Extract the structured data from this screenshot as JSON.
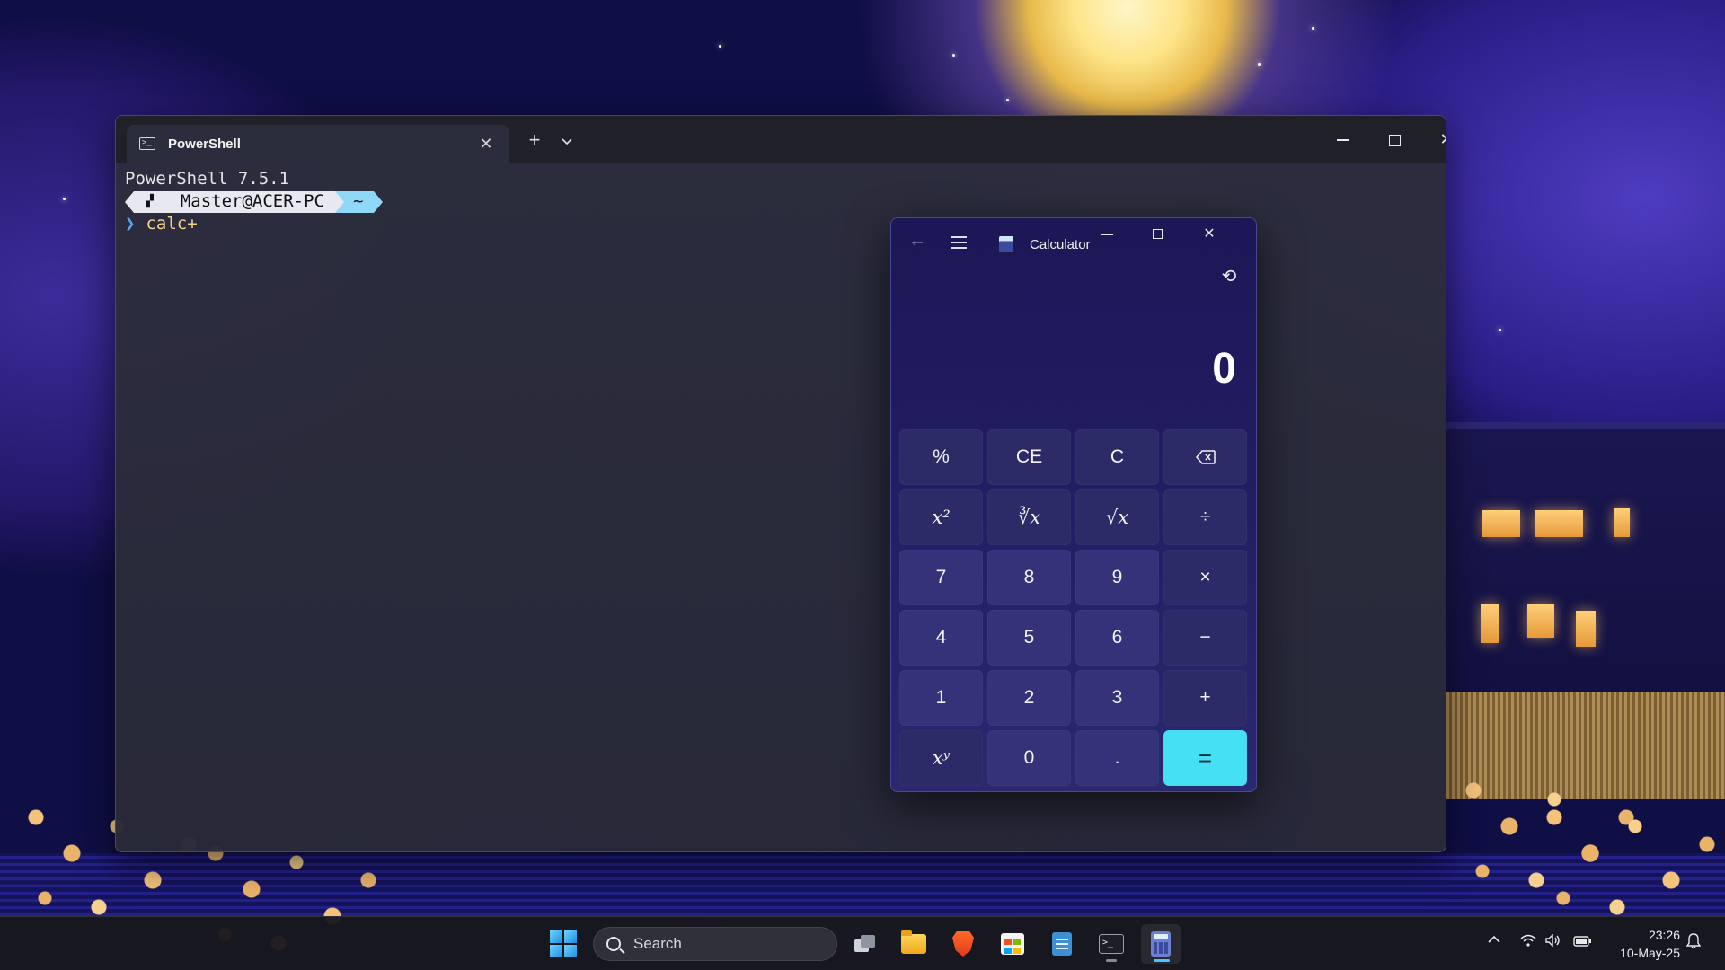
{
  "terminal": {
    "tab_title": "PowerShell",
    "tab_icon_glyph": ">_",
    "new_tab_label": "+",
    "dropdown_label": "⌄",
    "lines": {
      "version": "PowerShell 7.5.1",
      "prompt_user": "Master@ACER-PC",
      "prompt_path": "~",
      "prompt_chevron": "❯",
      "command": "calc+"
    }
  },
  "calculator": {
    "title": "Calculator",
    "display_value": "0",
    "back_glyph": "←",
    "history_glyph": "⟲",
    "keys": [
      {
        "label": "%",
        "kind": "fn"
      },
      {
        "label": "CE",
        "kind": "fn"
      },
      {
        "label": "C",
        "kind": "fn"
      },
      {
        "label": "⌫",
        "kind": "fn"
      },
      {
        "label": "x²",
        "kind": "fn"
      },
      {
        "label": "∛x",
        "kind": "fn"
      },
      {
        "label": "√x",
        "kind": "fn"
      },
      {
        "label": "÷",
        "kind": "op"
      },
      {
        "label": "7",
        "kind": "num"
      },
      {
        "label": "8",
        "kind": "num"
      },
      {
        "label": "9",
        "kind": "num"
      },
      {
        "label": "×",
        "kind": "op"
      },
      {
        "label": "4",
        "kind": "num"
      },
      {
        "label": "5",
        "kind": "num"
      },
      {
        "label": "6",
        "kind": "num"
      },
      {
        "label": "−",
        "kind": "op"
      },
      {
        "label": "1",
        "kind": "num"
      },
      {
        "label": "2",
        "kind": "num"
      },
      {
        "label": "3",
        "kind": "num"
      },
      {
        "label": "+",
        "kind": "op"
      },
      {
        "label": "xʸ",
        "kind": "fn"
      },
      {
        "label": "0",
        "kind": "num"
      },
      {
        "label": ".",
        "kind": "num"
      },
      {
        "label": "=",
        "kind": "equals"
      }
    ],
    "accent_color": "#46e0f5"
  },
  "taskbar": {
    "search_placeholder": "Search",
    "apps": [
      "task-view",
      "file-explorer",
      "brave-browser",
      "microsoft-store",
      "notepad",
      "terminal",
      "calculator"
    ],
    "tray": {
      "time": "23:26",
      "date": "10-May-25"
    }
  }
}
